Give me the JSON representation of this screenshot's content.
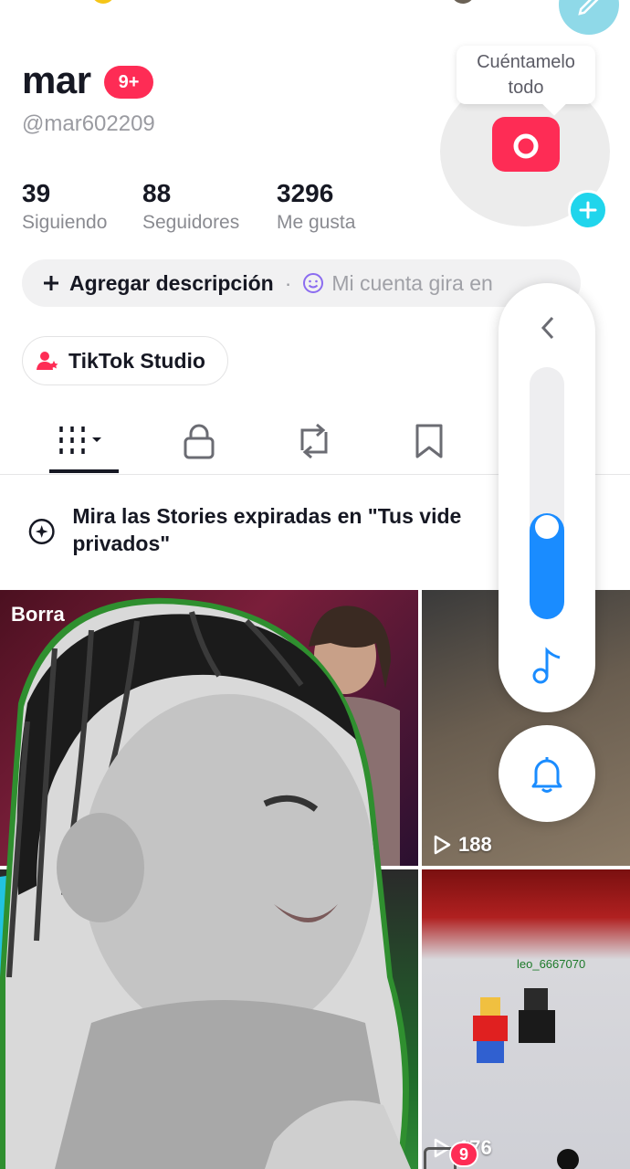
{
  "profile": {
    "name": "mar",
    "notification_badge": "9+",
    "handle": "@mar602209",
    "tooltip": "Cuéntamelo todo"
  },
  "stats": [
    {
      "value": "39",
      "label": "Siguiendo"
    },
    {
      "value": "88",
      "label": "Seguidores"
    },
    {
      "value": "3296",
      "label": "Me gusta"
    }
  ],
  "description_bar": {
    "add_label": "Agregar descripción",
    "separator": "·",
    "hint": "Mi cuenta gira en"
  },
  "studio_button": {
    "label": "TikTok Studio"
  },
  "tabs": [
    {
      "icon": "grid-icon",
      "active": true
    },
    {
      "icon": "lock-icon"
    },
    {
      "icon": "repost-icon"
    },
    {
      "icon": "bookmark-icon"
    }
  ],
  "stories_banner": {
    "text": "Mira las Stories expiradas en \"Tus vide privados\""
  },
  "grid": {
    "cell1": {
      "overlay": "Borra"
    },
    "cell2": {
      "views": "188"
    },
    "cell4": {
      "views": "176",
      "game_user": "leo_6667070"
    }
  },
  "side_panel": {
    "icons": [
      "chevron-left-icon",
      "music-note-icon",
      "bell-icon"
    ]
  },
  "bottom_nav": {
    "inbox_badge": "9"
  },
  "colors": {
    "accent": "#fe2c55",
    "cyan": "#20d5ec",
    "slider_blue": "#1a8cff"
  }
}
